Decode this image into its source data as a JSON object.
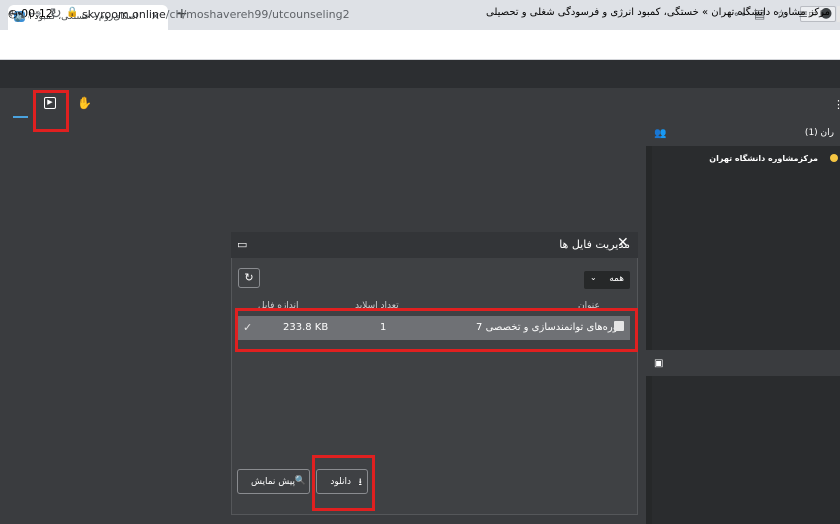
{
  "browser": {
    "tab_title": "اسکای‌روم - خستگی، کمبود انرژی و فرسو...",
    "tab_close": "✕",
    "new_tab": "+",
    "url_host": "skyroom.online",
    "url_path": "/ch/moshavereh99/utcounseling2",
    "nav": {
      "back": "←",
      "forward": "→",
      "reload": "↻"
    }
  },
  "header": {
    "timer": "00:12",
    "room_title": "مرکز مشاوره دانشگاه تهران » خستگی، کمبود انرژی و فرسودگی شغلی و تحصیلی"
  },
  "users_panel": {
    "label": "ران (1)",
    "user": "مرکزمشاوره دانشگاه تهران"
  },
  "file_dialog": {
    "title": "مدیریت فایل ها",
    "filter_value": "همه",
    "columns": {
      "name": "عنوان",
      "slides": "تعداد اسلاید",
      "size": "اندازه فایل"
    },
    "files": [
      {
        "name": "دوره‌های توانمندسازی و تخصصی 7",
        "slides": "1",
        "size": "233.8 KB"
      }
    ],
    "preview_label": "پیش نمایش",
    "download_label": "دانلود"
  },
  "colors": {
    "highlight": "#e02020",
    "app_bg": "#3a3c3f",
    "selected_row": "#6f7175"
  }
}
